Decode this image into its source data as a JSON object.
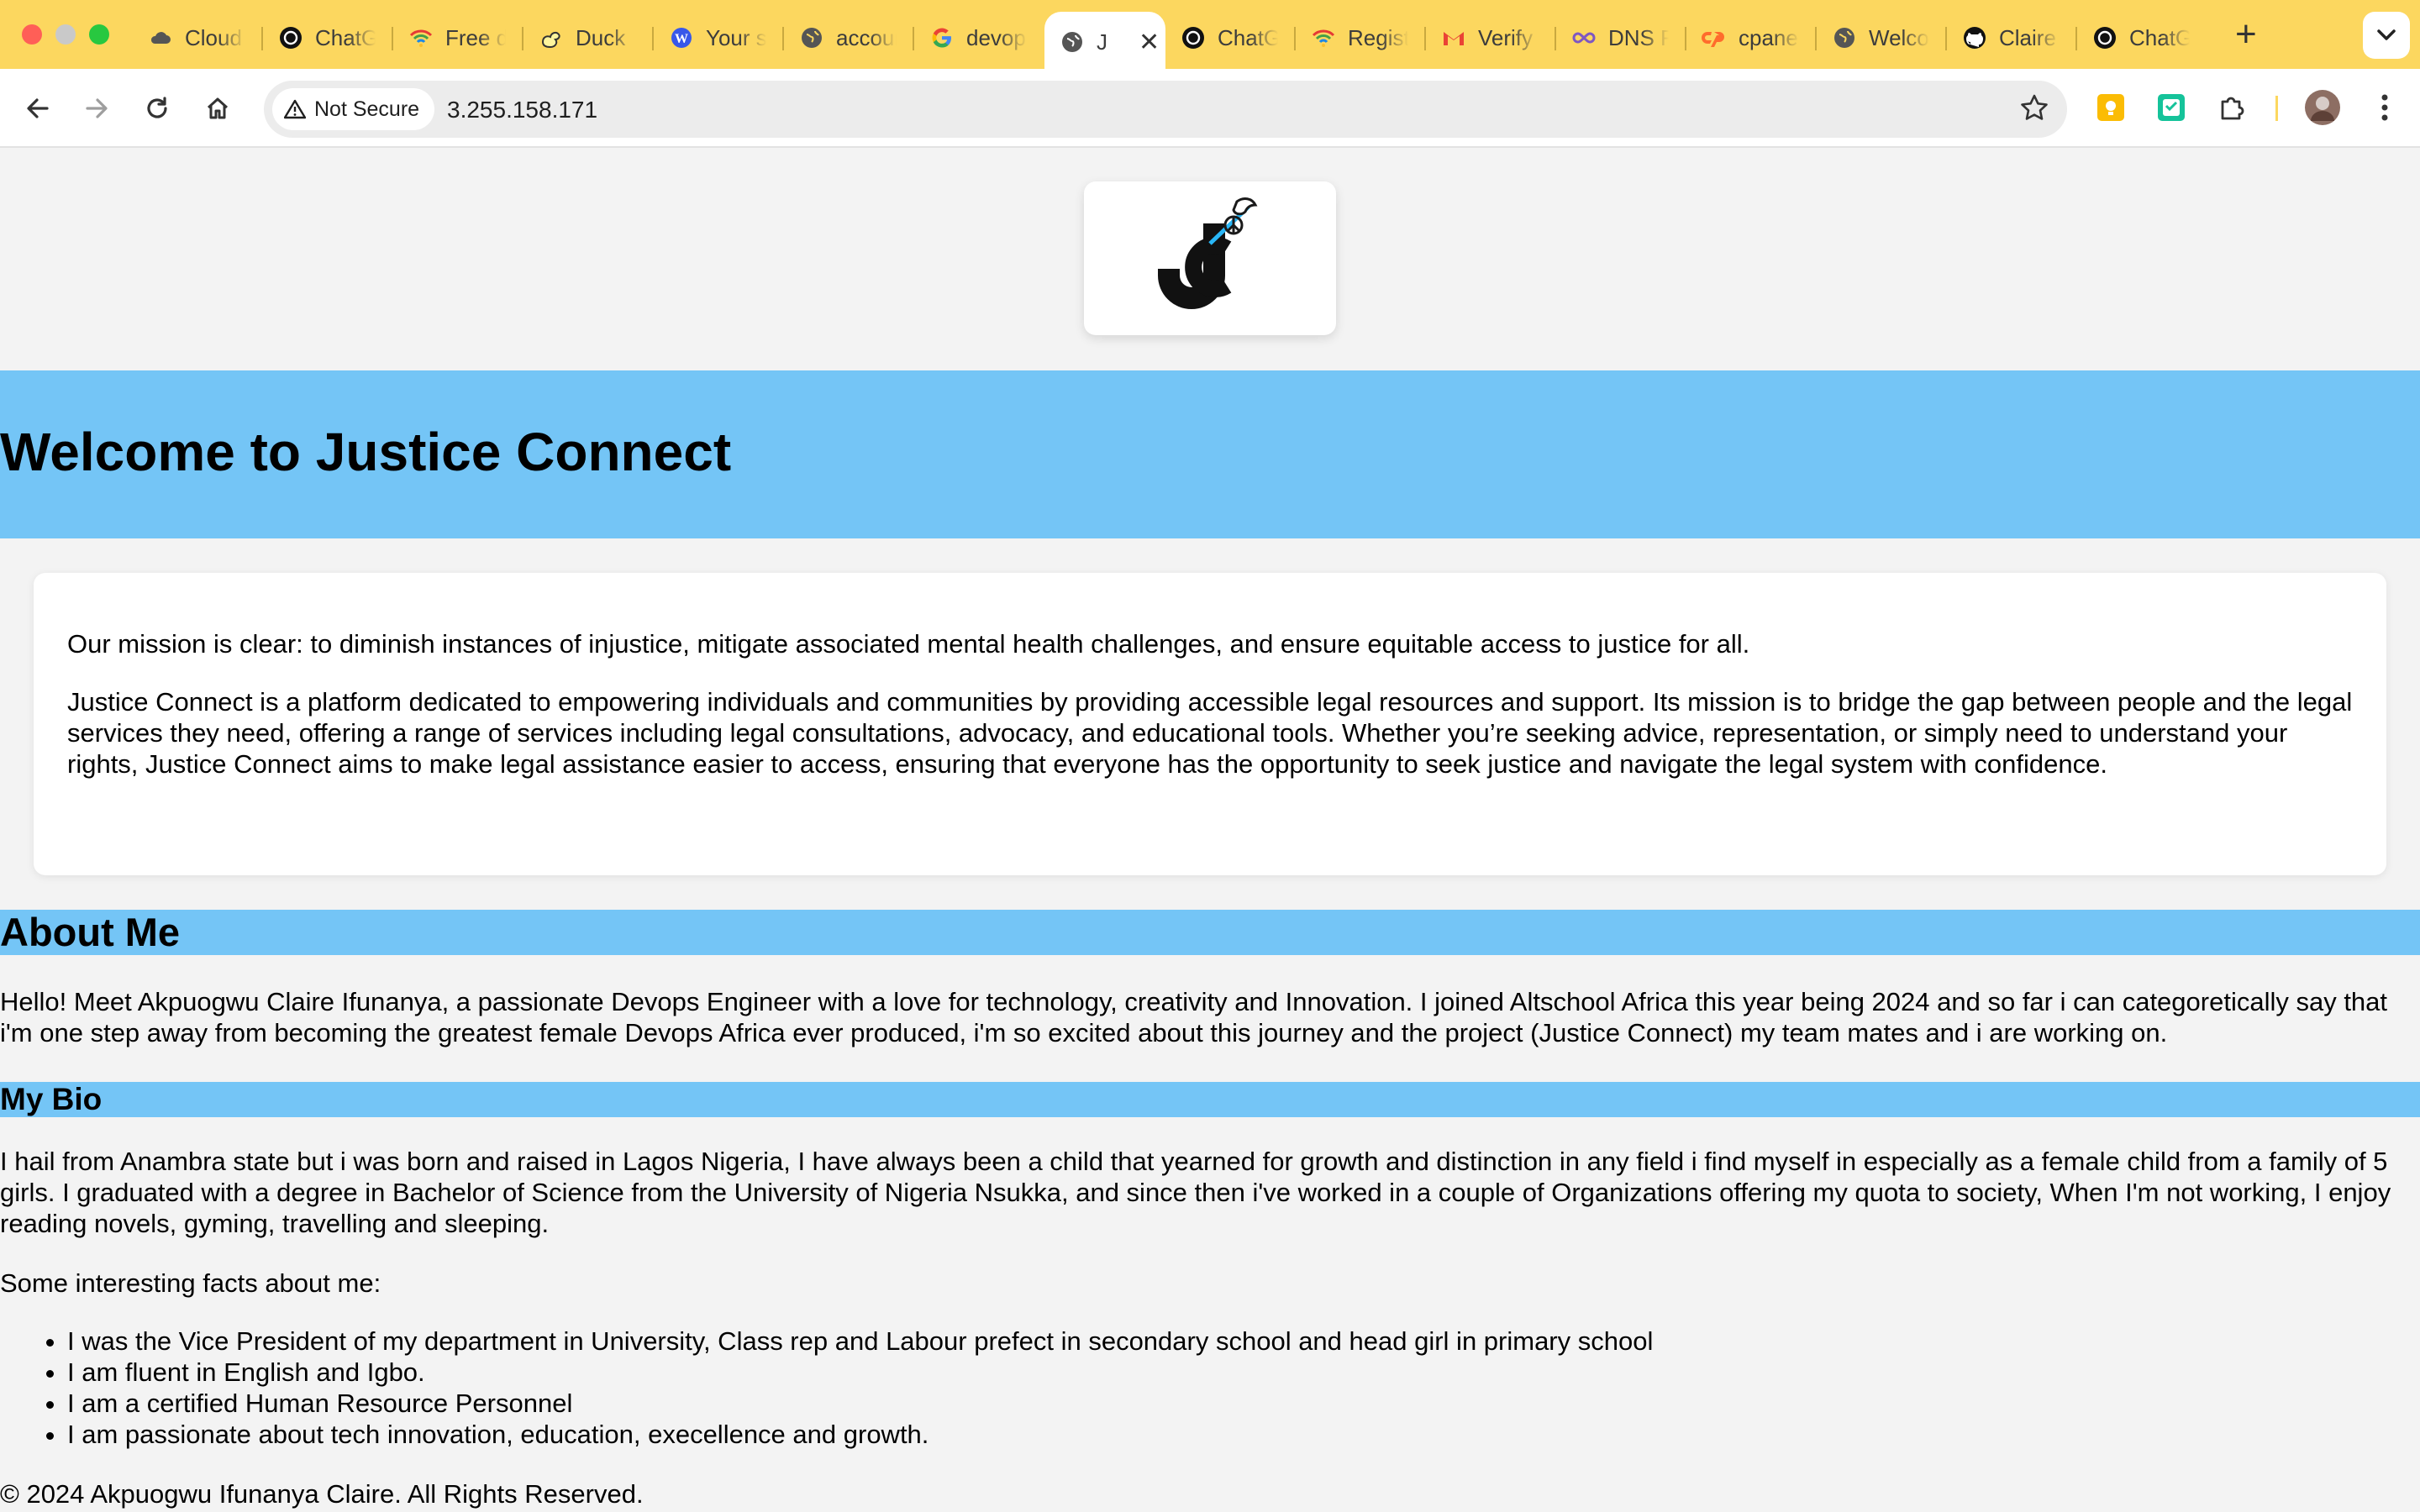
{
  "browser": {
    "tabs": [
      {
        "label": "Cloud",
        "icon": "cloud-icon"
      },
      {
        "label": "ChatGPT",
        "icon": "openai-icon"
      },
      {
        "label": "Free domain",
        "icon": "wifi-icon"
      },
      {
        "label": "Duck",
        "icon": "duck-icon"
      },
      {
        "label": "Your site",
        "icon": "wordpress-icon"
      },
      {
        "label": "account",
        "icon": "globe-icon"
      },
      {
        "label": "devops",
        "icon": "google-icon"
      },
      {
        "label": "J",
        "icon": "globe-icon",
        "active": true
      },
      {
        "label": "ChatGPT",
        "icon": "openai-icon"
      },
      {
        "label": "Register",
        "icon": "wifi-icon"
      },
      {
        "label": "Verify",
        "icon": "gmail-icon"
      },
      {
        "label": "DNS Records",
        "icon": "infinity-icon"
      },
      {
        "label": "cpanel",
        "icon": "cpanel-icon"
      },
      {
        "label": "Welcome",
        "icon": "globe-icon"
      },
      {
        "label": "Claire",
        "icon": "github-icon"
      },
      {
        "label": "ChatGPT",
        "icon": "openai-icon"
      }
    ],
    "security_label": "Not Secure",
    "url": "3.255.158.171"
  },
  "colors": {
    "tabbar": "#fcd75f",
    "accent_bar": "#74c5f6",
    "page_bg": "#f3f3f3"
  },
  "page": {
    "hero_title": "Welcome to Justice Connect",
    "mission_lead": "Our mission is clear: to diminish instances of injustice, mitigate associated mental health challenges, and ensure equitable access to justice for all.",
    "mission_body": "Justice Connect is a platform dedicated to empowering individuals and communities by providing accessible legal resources and support. Its mission is to bridge the gap between people and the legal services they need, offering a range of services including legal consultations, advocacy, and educational tools. Whether you’re seeking advice, representation, or simply need to understand your rights, Justice Connect aims to make legal assistance easier to access, ensuring that everyone has the opportunity to seek justice and navigate the legal system with confidence.",
    "about_heading": "About Me",
    "about_text": "Hello! Meet Akpuogwu Claire Ifunanya, a passionate Devops Engineer with a love for technology, creativity and Innovation. I joined Altschool Africa this year being 2024 and so far i can categoretically say that i'm one step away from becoming the greatest female Devops Africa ever produced, i'm so excited about this journey and the project (Justice Connect) my team mates and i are working on.",
    "bio_heading": "My Bio",
    "bio_text": "I hail from Anambra state but i was born and raised in Lagos Nigeria, I have always been a child that yearned for growth and distinction in any field i find myself in especially as a female child from a family of 5 girls. I graduated with a degree in Bachelor of Science from the University of Nigeria Nsukka, and since then i've worked in a couple of Organizations offering my quota to society, When I'm not working, I enjoy reading novels, gyming, travelling and sleeping.",
    "facts_intro": "Some interesting facts about me:",
    "facts": [
      "I was the Vice President of my department in University, Class rep and Labour prefect in secondary school and head girl in primary school",
      "I am fluent in English and Igbo.",
      "I am a certified Human Resource Personnel",
      "I am passionate about tech innovation, education, execellence and growth."
    ],
    "footer": "© 2024 Akpuogwu Ifunanya Claire. All Rights Reserved."
  }
}
